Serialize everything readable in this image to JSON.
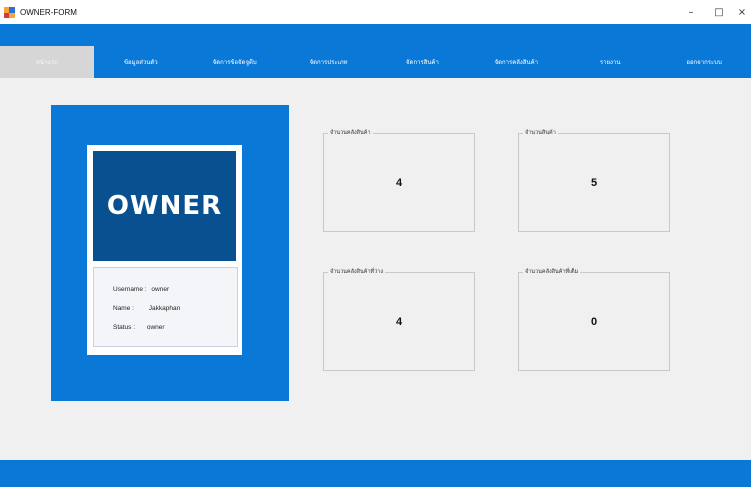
{
  "window": {
    "title": "OWNER-FORM",
    "controls": {
      "minimize": "–",
      "maximize": "□",
      "close": "×"
    }
  },
  "nav": {
    "items": [
      {
        "label": "หน้าแรก",
        "active": true
      },
      {
        "label": "ข้อมูลส่วนตัว",
        "active": false
      },
      {
        "label": "จัดการข้อจัดจูดีบ",
        "active": false
      },
      {
        "label": "จัดการประเภท",
        "active": false
      },
      {
        "label": "จัดการสินค้า",
        "active": false
      },
      {
        "label": "จัดการคลังสินค้า",
        "active": false
      },
      {
        "label": "รายงาน",
        "active": false
      },
      {
        "label": "ออกจากระบบ",
        "active": false
      }
    ]
  },
  "profile": {
    "logo_text": "OWNER",
    "username_label": "Username :",
    "username": "owner",
    "name_label": "Name :",
    "name": "Jakkaphan",
    "status_label": "Status :",
    "status": "owner"
  },
  "stats": [
    {
      "title": "จำนวนคลังสินค้า",
      "value": "4"
    },
    {
      "title": "จำนวนสินค้า",
      "value": "5"
    },
    {
      "title": "จำนวนคลังสินค้าที่ว่าง",
      "value": "4"
    },
    {
      "title": "จำนวนคลังสินค้าที่เต็ม",
      "value": "0"
    }
  ],
  "colors": {
    "accent": "#0a78d7",
    "logo_bg": "#08508f",
    "background": "#f0f0f0",
    "nav_active": "#d6d6d6"
  }
}
